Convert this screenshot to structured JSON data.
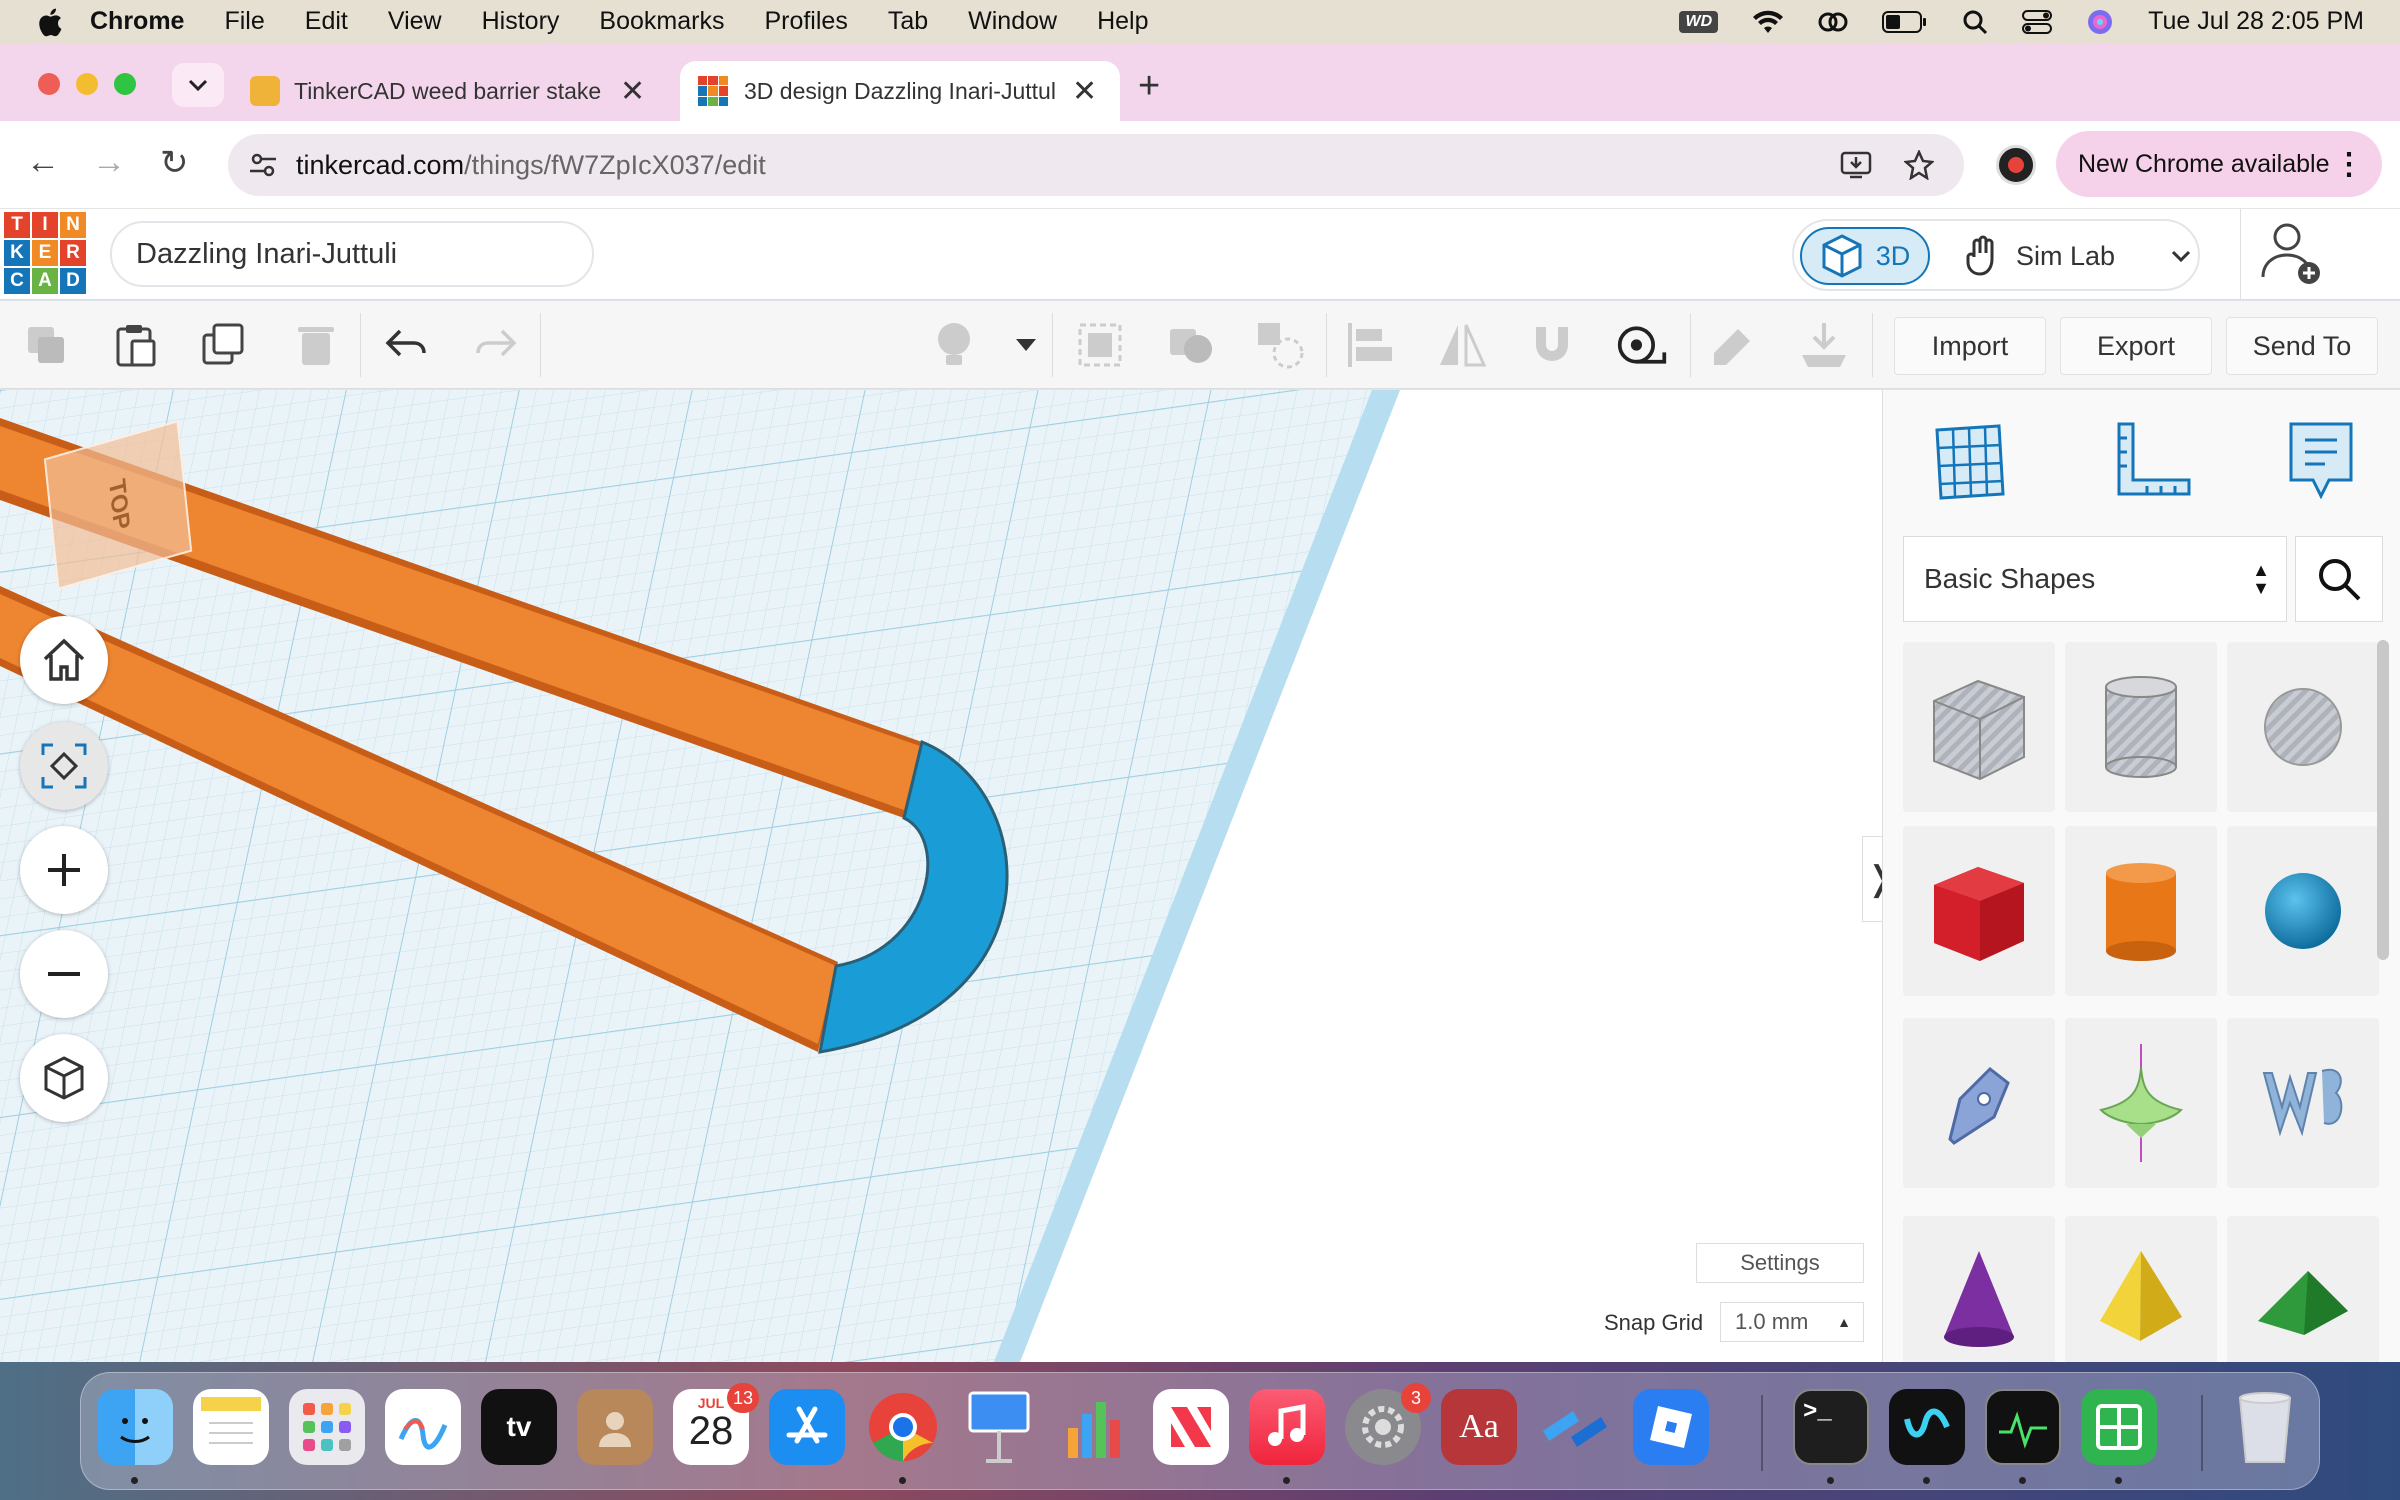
{
  "menubar": {
    "app": "Chrome",
    "items": [
      "File",
      "Edit",
      "View",
      "History",
      "Bookmarks",
      "Profiles",
      "Tab",
      "Window",
      "Help"
    ],
    "datetime": "Tue Jul 28  2:05 PM"
  },
  "browser": {
    "tabs": [
      {
        "title": "TinkerCAD weed barrier stake"
      },
      {
        "title": "3D design Dazzling Inari-Juttuli"
      }
    ],
    "url_host": "tinkercad.com",
    "url_path": "/things/fW7ZpIcX037/edit",
    "new_chrome": "New Chrome available"
  },
  "tinkercad": {
    "logo_letters": [
      "T",
      "I",
      "N",
      "K",
      "E",
      "R",
      "C",
      "A",
      "D"
    ],
    "logo_colors": [
      "#e2432a",
      "#e2432a",
      "#f08a24",
      "#1476b8",
      "#f08a24",
      "#e2432a",
      "#1476b8",
      "#69b344",
      "#1476b8"
    ],
    "design_title": "Dazzling Inari-Juttuli",
    "mode_3d": "3D",
    "mode_simlab": "Sim Lab",
    "buttons": {
      "import": "Import",
      "export": "Export",
      "send_to": "Send To"
    },
    "viewcube_label": "TOP",
    "shape_category": "Basic Shapes",
    "settings": "Settings",
    "snap_grid_label": "Snap Grid",
    "snap_grid_value": "1.0 mm",
    "shapes": [
      {
        "name": "box-hole",
        "color": "#b8bcc4"
      },
      {
        "name": "cylinder-hole",
        "color": "#b8bcc4"
      },
      {
        "name": "sphere-hole",
        "color": "#b8bcc4"
      },
      {
        "name": "box",
        "color": "#d21f2a"
      },
      {
        "name": "cylinder",
        "color": "#e87817"
      },
      {
        "name": "sphere",
        "color": "#1a8dc6"
      },
      {
        "name": "scribble",
        "color": "#8aa4d8"
      },
      {
        "name": "graphic",
        "color": "#a8e08a"
      },
      {
        "name": "text",
        "color": "#8fb3d9"
      },
      {
        "name": "cone",
        "color": "#7b2fa0"
      },
      {
        "name": "pyramid",
        "color": "#e6c12a"
      },
      {
        "name": "roof",
        "color": "#2f9a3c"
      }
    ],
    "colors": {
      "orange": "#ee8531",
      "blue": "#1a9dd6",
      "accent": "#1476b8"
    }
  },
  "dock": {
    "calendar_month": "JUL",
    "calendar_day": "28",
    "calendar_badge": "13",
    "settings_badge": "3",
    "dictionary": "Aa"
  }
}
